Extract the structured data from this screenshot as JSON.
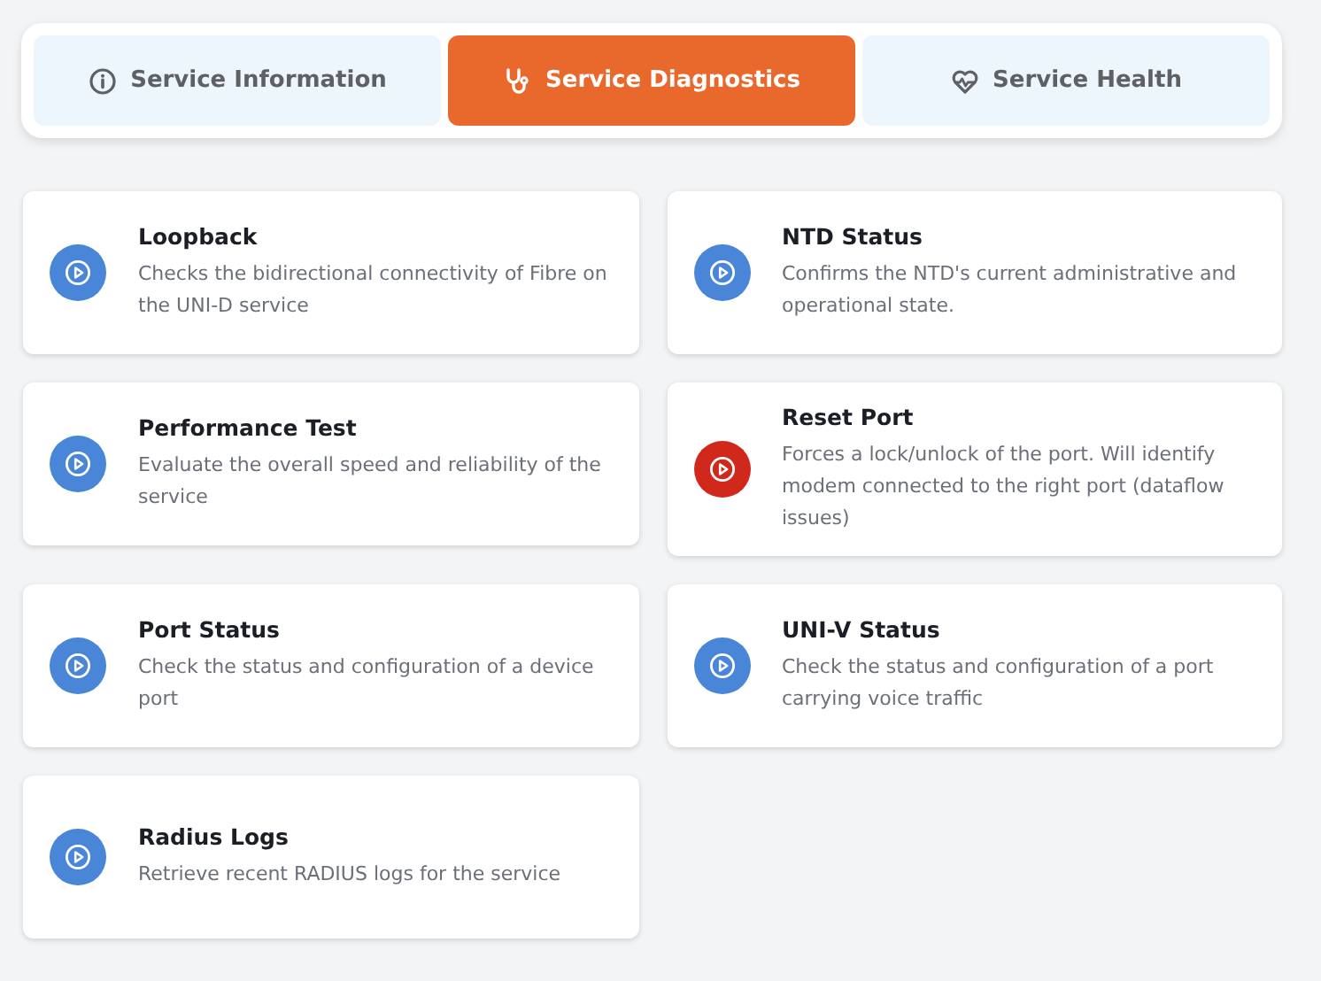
{
  "tabs": [
    {
      "label": "Service Information",
      "selected": false
    },
    {
      "label": "Service Diagnostics",
      "selected": true
    },
    {
      "label": "Service Health",
      "selected": false
    }
  ],
  "actions": [
    {
      "title": "Loopback",
      "description": "Checks the bidirectional connectivity of Fibre on the UNI-D service",
      "color": "#4a86d8"
    },
    {
      "title": "NTD Status",
      "description": "Confirms the NTD's current administrative and operational state.",
      "color": "#4a86d8"
    },
    {
      "title": "Performance Test",
      "description": "Evaluate the overall speed and reliability of the service",
      "color": "#4a86d8"
    },
    {
      "title": "Reset Port",
      "description": "Forces a lock/unlock of the port. Will identify modem connected to the right port (dataflow issues)",
      "color": "#d0281a"
    },
    {
      "title": "Port Status",
      "description": "Check the status and configuration of a device port",
      "color": "#4a86d8"
    },
    {
      "title": "UNI-V Status",
      "description": "Check the status and configuration of a port carrying voice traffic",
      "color": "#4a86d8"
    },
    {
      "title": "Radius Logs",
      "description": "Retrieve recent RADIUS logs for the service",
      "color": "#4a86d8"
    }
  ]
}
